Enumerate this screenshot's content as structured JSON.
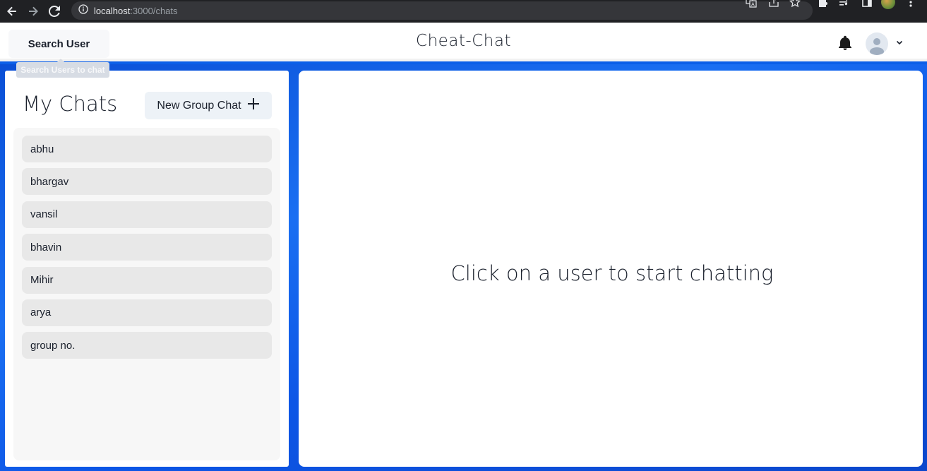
{
  "browser": {
    "url_host": "localhost",
    "url_path": ":3000/chats"
  },
  "header": {
    "search_button_label": "Search User",
    "tooltip": "Search Users to chat",
    "app_title": "Cheat-Chat"
  },
  "sidebar": {
    "title": "My Chats",
    "new_group_label": "New Group Chat",
    "chats": [
      {
        "name": "abhu"
      },
      {
        "name": "bhargav"
      },
      {
        "name": "vansil"
      },
      {
        "name": "bhavin"
      },
      {
        "name": "Mihir"
      },
      {
        "name": "arya"
      },
      {
        "name": "group no."
      }
    ]
  },
  "main": {
    "empty_message": "Click on a user to start chatting"
  },
  "colors": {
    "background_blue": "#0b5fe8",
    "chat_item_bg": "#e8e8e8",
    "button_bg": "#edf2f7"
  }
}
